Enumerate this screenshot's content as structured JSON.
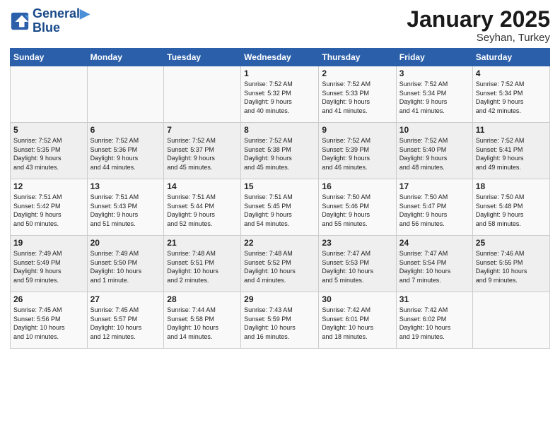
{
  "logo": {
    "line1": "General",
    "line2": "Blue"
  },
  "title": "January 2025",
  "subtitle": "Seyhan, Turkey",
  "days_header": [
    "Sunday",
    "Monday",
    "Tuesday",
    "Wednesday",
    "Thursday",
    "Friday",
    "Saturday"
  ],
  "weeks": [
    [
      {
        "day": "",
        "info": ""
      },
      {
        "day": "",
        "info": ""
      },
      {
        "day": "",
        "info": ""
      },
      {
        "day": "1",
        "info": "Sunrise: 7:52 AM\nSunset: 5:32 PM\nDaylight: 9 hours\nand 40 minutes."
      },
      {
        "day": "2",
        "info": "Sunrise: 7:52 AM\nSunset: 5:33 PM\nDaylight: 9 hours\nand 41 minutes."
      },
      {
        "day": "3",
        "info": "Sunrise: 7:52 AM\nSunset: 5:34 PM\nDaylight: 9 hours\nand 41 minutes."
      },
      {
        "day": "4",
        "info": "Sunrise: 7:52 AM\nSunset: 5:34 PM\nDaylight: 9 hours\nand 42 minutes."
      }
    ],
    [
      {
        "day": "5",
        "info": "Sunrise: 7:52 AM\nSunset: 5:35 PM\nDaylight: 9 hours\nand 43 minutes."
      },
      {
        "day": "6",
        "info": "Sunrise: 7:52 AM\nSunset: 5:36 PM\nDaylight: 9 hours\nand 44 minutes."
      },
      {
        "day": "7",
        "info": "Sunrise: 7:52 AM\nSunset: 5:37 PM\nDaylight: 9 hours\nand 45 minutes."
      },
      {
        "day": "8",
        "info": "Sunrise: 7:52 AM\nSunset: 5:38 PM\nDaylight: 9 hours\nand 45 minutes."
      },
      {
        "day": "9",
        "info": "Sunrise: 7:52 AM\nSunset: 5:39 PM\nDaylight: 9 hours\nand 46 minutes."
      },
      {
        "day": "10",
        "info": "Sunrise: 7:52 AM\nSunset: 5:40 PM\nDaylight: 9 hours\nand 48 minutes."
      },
      {
        "day": "11",
        "info": "Sunrise: 7:52 AM\nSunset: 5:41 PM\nDaylight: 9 hours\nand 49 minutes."
      }
    ],
    [
      {
        "day": "12",
        "info": "Sunrise: 7:51 AM\nSunset: 5:42 PM\nDaylight: 9 hours\nand 50 minutes."
      },
      {
        "day": "13",
        "info": "Sunrise: 7:51 AM\nSunset: 5:43 PM\nDaylight: 9 hours\nand 51 minutes."
      },
      {
        "day": "14",
        "info": "Sunrise: 7:51 AM\nSunset: 5:44 PM\nDaylight: 9 hours\nand 52 minutes."
      },
      {
        "day": "15",
        "info": "Sunrise: 7:51 AM\nSunset: 5:45 PM\nDaylight: 9 hours\nand 54 minutes."
      },
      {
        "day": "16",
        "info": "Sunrise: 7:50 AM\nSunset: 5:46 PM\nDaylight: 9 hours\nand 55 minutes."
      },
      {
        "day": "17",
        "info": "Sunrise: 7:50 AM\nSunset: 5:47 PM\nDaylight: 9 hours\nand 56 minutes."
      },
      {
        "day": "18",
        "info": "Sunrise: 7:50 AM\nSunset: 5:48 PM\nDaylight: 9 hours\nand 58 minutes."
      }
    ],
    [
      {
        "day": "19",
        "info": "Sunrise: 7:49 AM\nSunset: 5:49 PM\nDaylight: 9 hours\nand 59 minutes."
      },
      {
        "day": "20",
        "info": "Sunrise: 7:49 AM\nSunset: 5:50 PM\nDaylight: 10 hours\nand 1 minute."
      },
      {
        "day": "21",
        "info": "Sunrise: 7:48 AM\nSunset: 5:51 PM\nDaylight: 10 hours\nand 2 minutes."
      },
      {
        "day": "22",
        "info": "Sunrise: 7:48 AM\nSunset: 5:52 PM\nDaylight: 10 hours\nand 4 minutes."
      },
      {
        "day": "23",
        "info": "Sunrise: 7:47 AM\nSunset: 5:53 PM\nDaylight: 10 hours\nand 5 minutes."
      },
      {
        "day": "24",
        "info": "Sunrise: 7:47 AM\nSunset: 5:54 PM\nDaylight: 10 hours\nand 7 minutes."
      },
      {
        "day": "25",
        "info": "Sunrise: 7:46 AM\nSunset: 5:55 PM\nDaylight: 10 hours\nand 9 minutes."
      }
    ],
    [
      {
        "day": "26",
        "info": "Sunrise: 7:45 AM\nSunset: 5:56 PM\nDaylight: 10 hours\nand 10 minutes."
      },
      {
        "day": "27",
        "info": "Sunrise: 7:45 AM\nSunset: 5:57 PM\nDaylight: 10 hours\nand 12 minutes."
      },
      {
        "day": "28",
        "info": "Sunrise: 7:44 AM\nSunset: 5:58 PM\nDaylight: 10 hours\nand 14 minutes."
      },
      {
        "day": "29",
        "info": "Sunrise: 7:43 AM\nSunset: 5:59 PM\nDaylight: 10 hours\nand 16 minutes."
      },
      {
        "day": "30",
        "info": "Sunrise: 7:42 AM\nSunset: 6:01 PM\nDaylight: 10 hours\nand 18 minutes."
      },
      {
        "day": "31",
        "info": "Sunrise: 7:42 AM\nSunset: 6:02 PM\nDaylight: 10 hours\nand 19 minutes."
      },
      {
        "day": "",
        "info": ""
      }
    ]
  ]
}
